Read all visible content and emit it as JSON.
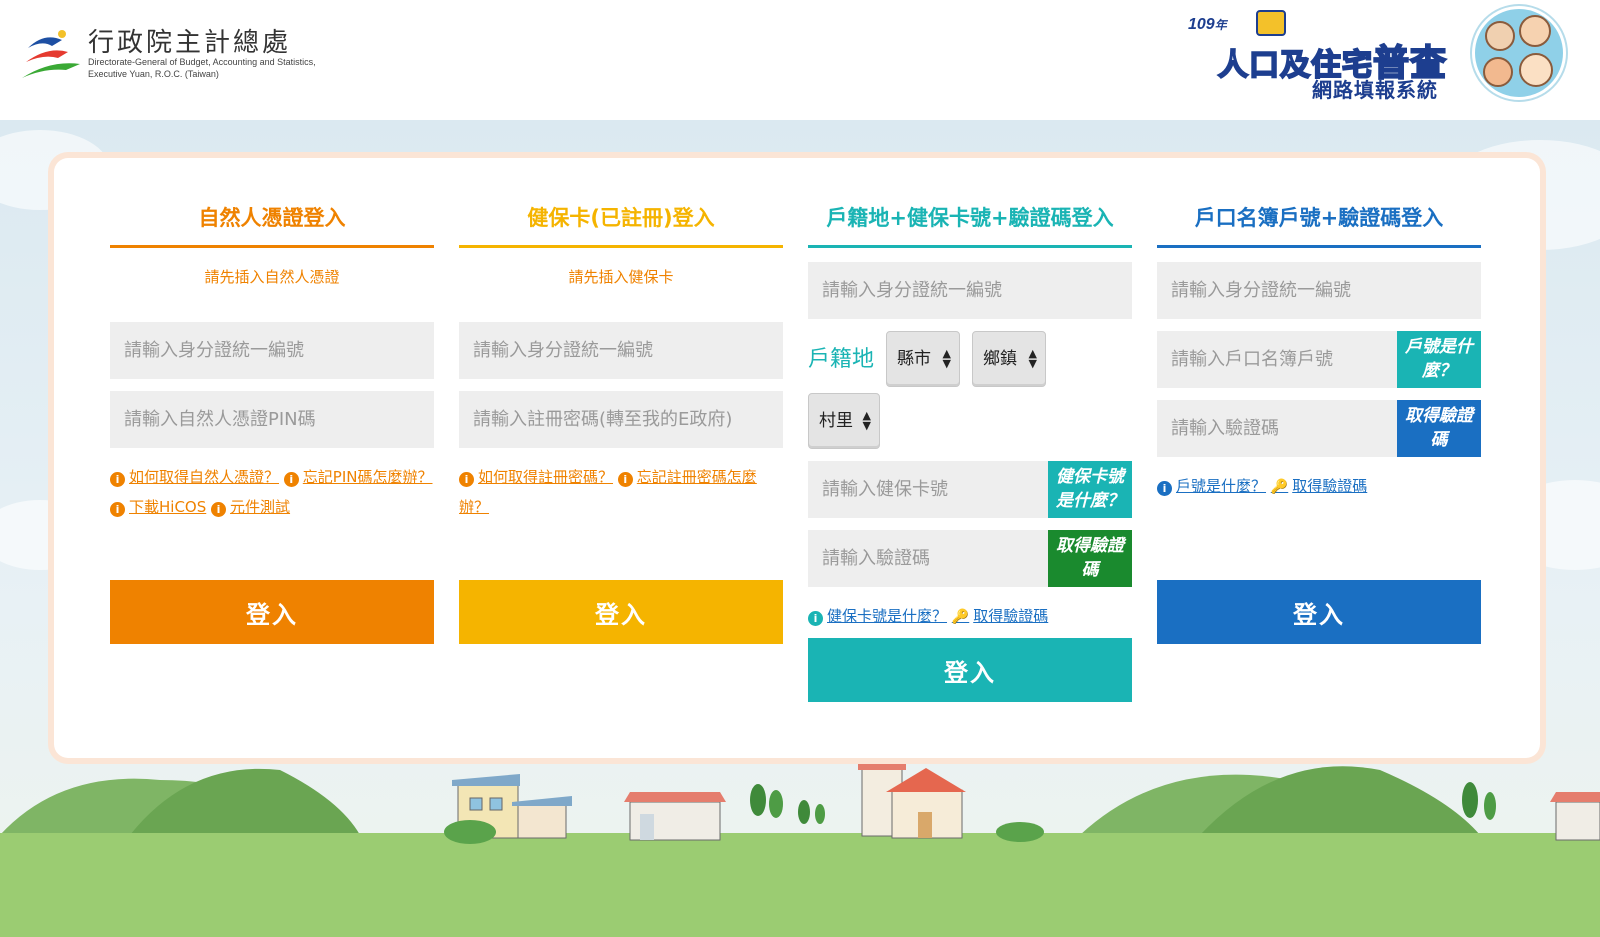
{
  "header": {
    "org_name_zh": "行政院主計總處",
    "org_name_en_line1": "Directorate-General of Budget, Accounting and Statistics,",
    "org_name_en_line2": "Executive Yuan, R.O.C. (Taiwan)",
    "census_year": "109",
    "census_year_unit": "年",
    "census_title_a": "人口及住宅",
    "census_title_b": "普查",
    "census_subtitle": "網路填報系統"
  },
  "col1": {
    "title": "自然人憑證登入",
    "hint": "請先插入自然人憑證",
    "id_placeholder": "請輸入身分證統一編號",
    "pin_placeholder": "請輸入自然人憑證PIN碼",
    "link1": "如何取得自然人憑證？",
    "link2": "忘記PIN碼怎麼辦？",
    "link3": "下載HiCOS",
    "link4": "元件測試",
    "login": "登入"
  },
  "col2": {
    "title": "健保卡(已註冊)登入",
    "hint": "請先插入健保卡",
    "id_placeholder": "請輸入身分證統一編號",
    "pwd_placeholder": "請輸入註冊密碼(轉至我的E政府)",
    "link1": "如何取得註冊密碼？",
    "link2": "忘記註冊密碼怎麼辦？",
    "login": "登入"
  },
  "col3": {
    "title": "戶籍地+健保卡號+驗證碼登入",
    "id_placeholder": "請輸入身分證統一編號",
    "household_label": "戶籍地",
    "county_select": "縣市",
    "township_select": "鄉鎮",
    "village_select": "村里",
    "card_placeholder": "請輸入健保卡號",
    "card_help": "健保卡號是什麼？",
    "code_placeholder": "請輸入驗證碼",
    "get_code": "取得驗證碼",
    "link1": "健保卡號是什麼？",
    "link2": "取得驗證碼",
    "login": "登入"
  },
  "col4": {
    "title": "戶口名簿戶號+驗證碼登入",
    "id_placeholder": "請輸入身分證統一編號",
    "household_placeholder": "請輸入戶口名簿戶號",
    "household_help": "戶號是什麼？",
    "code_placeholder": "請輸入驗證碼",
    "get_code": "取得驗證碼",
    "link1": "戶號是什麼？",
    "link2": "取得驗證碼",
    "login": "登入"
  },
  "colors": {
    "orange": "#ef8200",
    "yellow": "#f5b400",
    "teal": "#1ab4b4",
    "blue": "#1a6fc2",
    "dark_green": "#1a8a2e"
  }
}
